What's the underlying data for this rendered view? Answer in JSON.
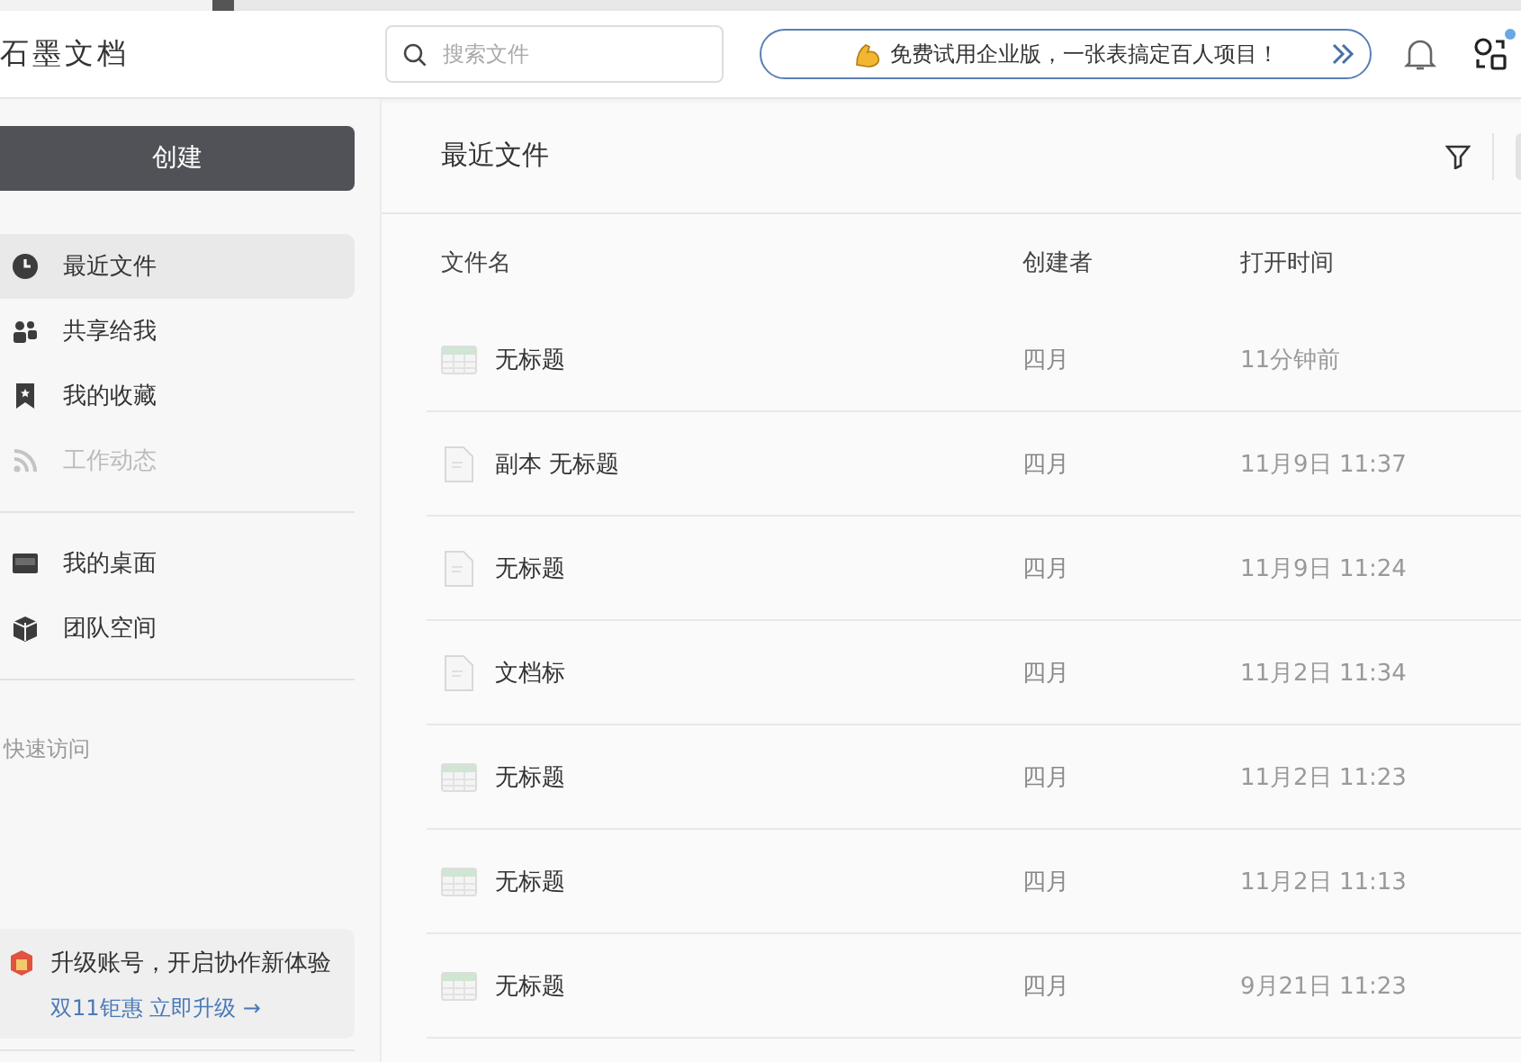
{
  "app": {
    "title": "石墨文档"
  },
  "search": {
    "placeholder": "搜索文件"
  },
  "promo_banner": {
    "text": "免费试用企业版，一张表搞定百人项目！"
  },
  "notifications": {
    "unread": true
  },
  "sidebar": {
    "create_button": "创建",
    "items": [
      {
        "label": "最近文件",
        "selected": true,
        "disabled": false
      },
      {
        "label": "共享给我",
        "selected": false,
        "disabled": false
      },
      {
        "label": "我的收藏",
        "selected": false,
        "disabled": false
      },
      {
        "label": "工作动态",
        "selected": false,
        "disabled": true
      }
    ],
    "space_items": [
      {
        "label": "我的桌面",
        "selected": false,
        "disabled": false
      },
      {
        "label": "团队空间",
        "selected": false,
        "disabled": false
      }
    ],
    "quick_access": "快速访问",
    "upgrade_card": {
      "title": "升级账号，开启协作新体验",
      "link": "双11钜惠 立即升级 →"
    }
  },
  "main": {
    "title": "最近文件",
    "table": {
      "columns": [
        "文件名",
        "创建者",
        "打开时间"
      ],
      "rows": [
        {
          "kind": "sheet",
          "name": "无标题",
          "creator": "四月",
          "opened": "11分钟前"
        },
        {
          "kind": "doc",
          "name": "副本 无标题",
          "creator": "四月",
          "opened": "11月9日 11:37"
        },
        {
          "kind": "doc",
          "name": "无标题",
          "creator": "四月",
          "opened": "11月9日 11:24"
        },
        {
          "kind": "doc",
          "name": "文档标",
          "creator": "四月",
          "opened": "11月2日 11:34"
        },
        {
          "kind": "sheet",
          "name": "无标题",
          "creator": "四月",
          "opened": "11月2日 11:23"
        },
        {
          "kind": "sheet",
          "name": "无标题",
          "creator": "四月",
          "opened": "11月2日 11:13"
        },
        {
          "kind": "sheet",
          "name": "无标题",
          "creator": "四月",
          "opened": "9月21日 11:23"
        }
      ]
    }
  }
}
